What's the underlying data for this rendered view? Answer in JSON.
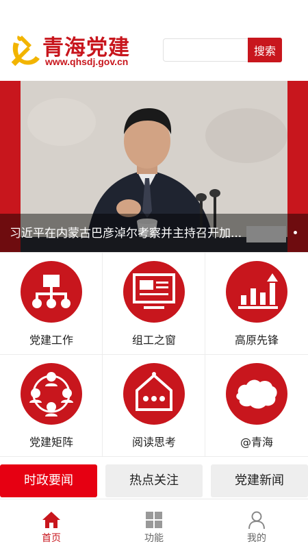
{
  "header": {
    "logo_title": "青海党建",
    "logo_url": "www.qhsdj.gov.cn",
    "search_placeholder": "",
    "search_button": "搜索"
  },
  "banner": {
    "caption": "习近平在内蒙古巴彦淖尔考察并主持召开加...",
    "slide_count": 1
  },
  "grid": {
    "items": [
      {
        "label": "党建工作",
        "icon": "org-chart-icon"
      },
      {
        "label": "组工之窗",
        "icon": "monitor-icon"
      },
      {
        "label": "高原先锋",
        "icon": "growth-chart-icon"
      },
      {
        "label": "党建矩阵",
        "icon": "people-network-icon"
      },
      {
        "label": "阅读思考",
        "icon": "house-dots-icon"
      },
      {
        "label": "@青海",
        "icon": "qinghai-map-icon"
      }
    ]
  },
  "tabs": [
    {
      "label": "时政要闻",
      "active": true
    },
    {
      "label": "热点关注",
      "active": false
    },
    {
      "label": "党建新闻",
      "active": false
    }
  ],
  "bottom_nav": [
    {
      "label": "首页",
      "icon": "home-icon",
      "active": true
    },
    {
      "label": "功能",
      "icon": "grid-icon",
      "active": false
    },
    {
      "label": "我的",
      "icon": "user-icon",
      "active": false
    }
  ],
  "colors": {
    "brand_red": "#c8161d",
    "tab_active": "#e60012",
    "tab_inactive": "#eeeeee",
    "nav_active": "#c8161d",
    "nav_inactive": "#999999"
  }
}
